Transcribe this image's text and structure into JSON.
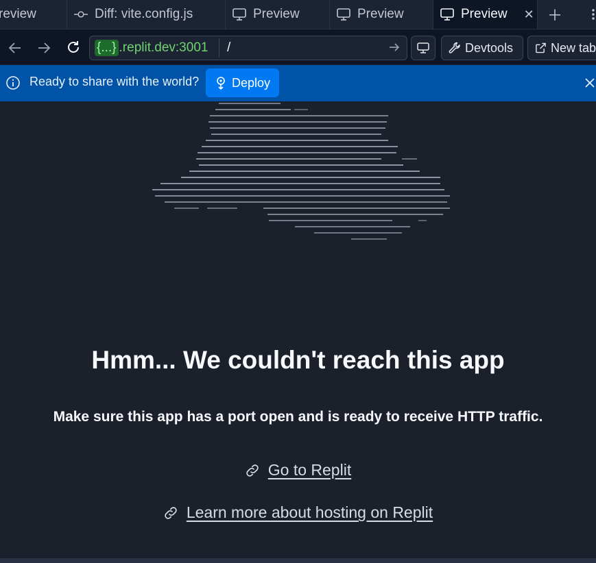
{
  "tabs": [
    {
      "label": "review",
      "icon": "none",
      "active": false
    },
    {
      "label": "Diff: vite.config.js",
      "icon": "git-commit-icon",
      "active": false
    },
    {
      "label": "Preview",
      "icon": "monitor-icon",
      "active": false
    },
    {
      "label": "Preview",
      "icon": "monitor-icon",
      "active": false
    },
    {
      "label": "Preview",
      "icon": "monitor-icon",
      "active": true
    }
  ],
  "address": {
    "badge": "{...}",
    "host": ".replit.dev:3001",
    "path": "/"
  },
  "toolbar": {
    "devtools_label": "Devtools",
    "new_tab_label": "New tab"
  },
  "banner": {
    "message": "Ready to share with the world?",
    "deploy_label": "Deploy"
  },
  "content": {
    "title": "Hmm... We couldn't reach this app",
    "subtitle": "Make sure this app has a port open and is ready to receive HTTP traffic.",
    "links": [
      {
        "label": "Go to Replit"
      },
      {
        "label": "Learn more about hosting on Replit"
      }
    ]
  },
  "colors": {
    "page_bg": "#1c202b",
    "banner_bg": "#0053a6",
    "deploy_button": "#0079f2",
    "host_green": "#6fd46f"
  }
}
